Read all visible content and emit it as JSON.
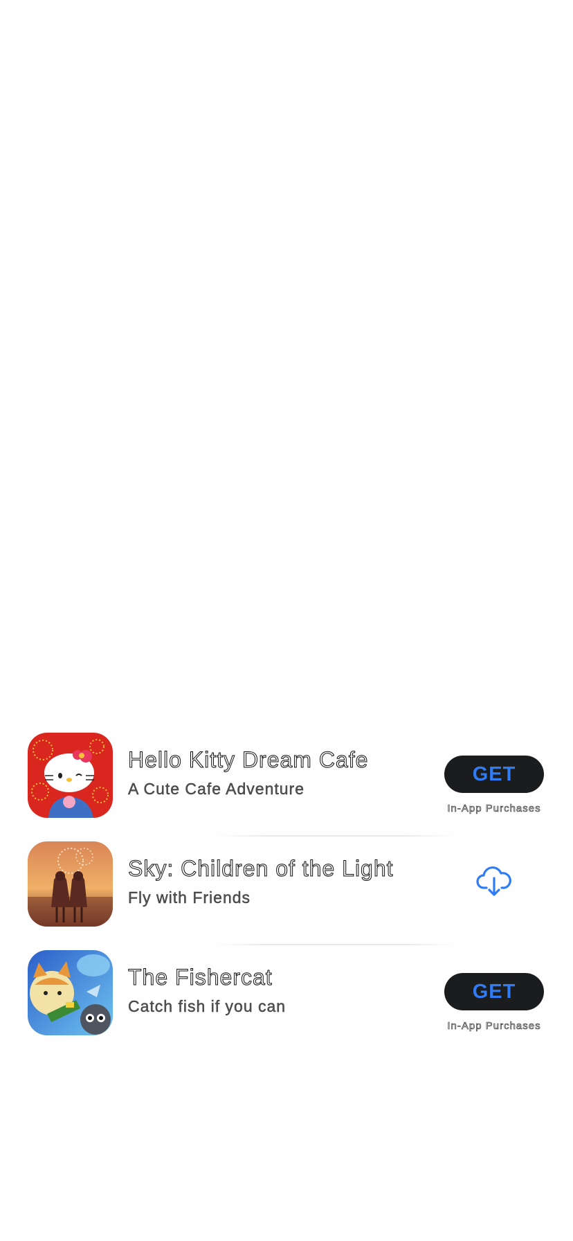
{
  "apps": [
    {
      "title": "Hello Kitty Dream Cafe",
      "subtitle": "A Cute Cafe Adventure",
      "icon": "hello-kitty-app-icon",
      "action": "GET",
      "action_note": "In-App Purchases"
    },
    {
      "title": "Sky: Children of the Light",
      "subtitle": "Fly with Friends",
      "icon": "sky-app-icon",
      "action": "cloud-download-icon"
    },
    {
      "title": "The Fishercat",
      "subtitle": "Catch fish if you can",
      "icon": "fishercat-app-icon",
      "action": "GET",
      "action_note": "In-App Purchases"
    }
  ],
  "colors": {
    "accent": "#2f7cf6",
    "button_bg": "#1b1c1e",
    "background": "#fefefe"
  }
}
